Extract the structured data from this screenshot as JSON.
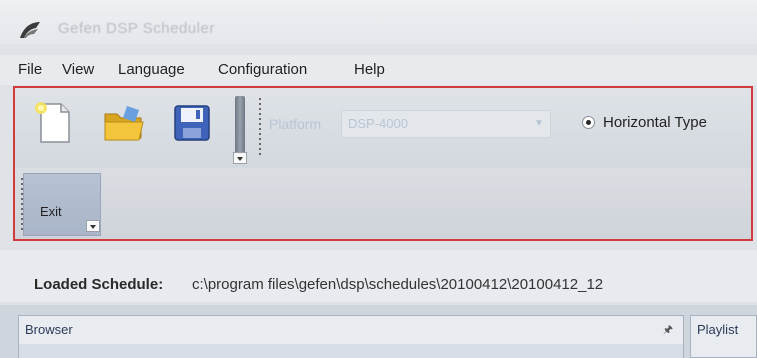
{
  "window": {
    "title": "Gefen DSP Scheduler"
  },
  "menu": {
    "items": [
      "File",
      "View",
      "Language",
      "Configuration",
      "Help"
    ]
  },
  "toolbar": {
    "new_icon": "new-document-icon",
    "open_icon": "open-folder-icon",
    "save_icon": "save-disk-icon",
    "platform_label": "Platform",
    "platform_value": "DSP-4000",
    "horizontal_type_label": "Horizontal Type",
    "horizontal_type_selected": true,
    "exit_label": "Exit"
  },
  "status": {
    "loaded_label": "Loaded Schedule:",
    "loaded_path": "c:\\program files\\gefen\\dsp\\schedules\\20100412\\20100412_12"
  },
  "panels": {
    "browser_title": "Browser",
    "player_title": "Playlist"
  },
  "colors": {
    "highlight_border": "#d23b3b"
  }
}
